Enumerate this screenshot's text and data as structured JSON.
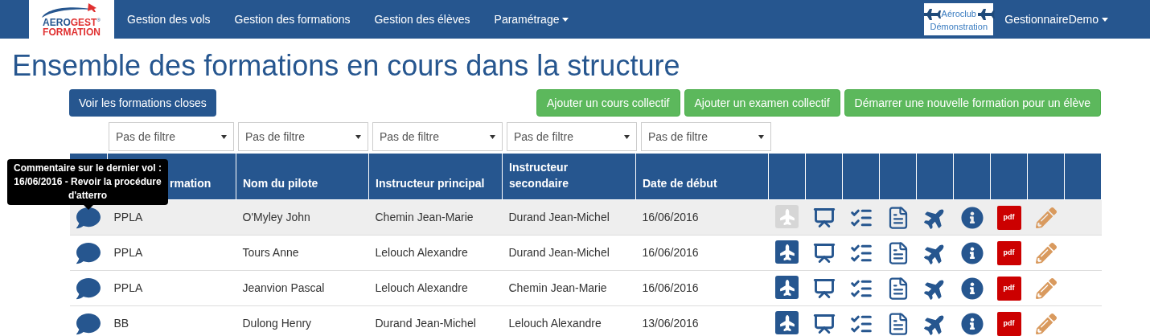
{
  "navbar": {
    "logo": {
      "top_a": "AERO",
      "top_b": "GEST",
      "reg": "®",
      "bottom": "FORMATION"
    },
    "menu": [
      {
        "label": "Gestion des vols",
        "dropdown": false
      },
      {
        "label": "Gestion des formations",
        "dropdown": false
      },
      {
        "label": "Gestion des élèves",
        "dropdown": false
      },
      {
        "label": "Paramétrage",
        "dropdown": true
      }
    ],
    "club_logo": {
      "line1": "Aéroclub",
      "line2": "Démonstration"
    },
    "user": {
      "label": "GestionnaireDemo",
      "dropdown": true
    }
  },
  "title": "Ensemble des formations en cours dans la structure",
  "left_button": "Voir les formations closes",
  "right_buttons": [
    "Ajouter un cours collectif",
    "Ajouter un examen collectif",
    "Démarrer une nouvelle formation pour un élève"
  ],
  "filters": [
    {
      "value": "Pas de filtre"
    },
    {
      "value": "Pas de filtre"
    },
    {
      "value": "Pas de filtre"
    },
    {
      "value": "Pas de filtre"
    },
    {
      "value": "Pas de filtre"
    }
  ],
  "table": {
    "columns": [
      "rmation",
      "Nom du pilote",
      "Instructeur principal",
      "Instructeur secondaire",
      "Date de début"
    ],
    "rows": [
      {
        "highlighted": true,
        "plan": "PPLA",
        "pilot": "O'Myley John",
        "instructor": "Chemin Jean-Marie",
        "second_instructor": "Durand Jean-Michel",
        "start": "16/06/2016",
        "flight_enabled": false,
        "pdf_label": "pdf"
      },
      {
        "highlighted": false,
        "plan": "PPLA",
        "pilot": "Tours Anne",
        "instructor": "Lelouch Alexandre",
        "second_instructor": "Durand Jean-Michel",
        "start": "16/06/2016",
        "flight_enabled": true,
        "pdf_label": "pdf"
      },
      {
        "highlighted": false,
        "plan": "PPLA",
        "pilot": "Jeanvion Pascal",
        "instructor": "Lelouch Alexandre",
        "second_instructor": "Chemin Jean-Marie",
        "start": "16/06/2016",
        "flight_enabled": true,
        "pdf_label": "pdf"
      },
      {
        "highlighted": false,
        "plan": "BB",
        "pilot": "Dulong Henry",
        "instructor": "Durand Jean-Michel",
        "second_instructor": "Lelouch Alexandre",
        "start": "13/06/2016",
        "flight_enabled": true,
        "pdf_label": "pdf"
      }
    ]
  },
  "tooltip": {
    "text": "Commentaire sur le dernier vol : 16/06/2016 - Revoir la procédure d'atterro"
  }
}
